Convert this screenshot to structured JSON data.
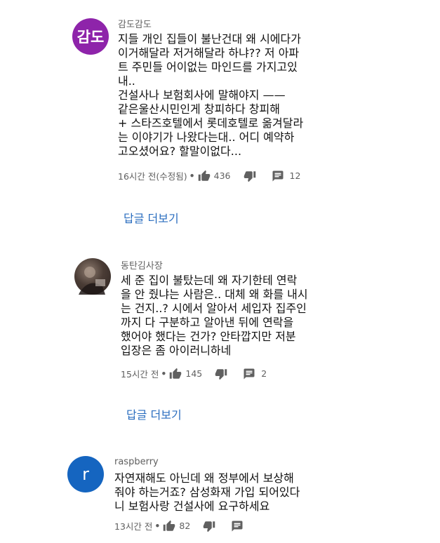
{
  "comments": [
    {
      "author": "감도감도",
      "avatar_text": "감도",
      "avatar_color": "#8e24aa",
      "lines": [
        "지들 개인 집들이 불난건대 왜 시에다가",
        "이거해달라 저거해달라 하냐?? 저 아파",
        "트 주민들 어이없는 마인드를 가지고있",
        "내..",
        "건설사나 보험회사에 말해야지 ——",
        "같은울산시민인게 창피하다 창피해",
        "+ 스타즈호텔에서 롯데호텔로 옮겨달라",
        "는 이야기가 나왔다는대.. 어디 예약하",
        "고오셨어요? 할말이없다..."
      ],
      "time": "16시간 전(수정됨)",
      "likes": "436",
      "replies_count": "12",
      "reply_more": "답글 더보기"
    },
    {
      "author": "동탄김사장",
      "avatar_text": "",
      "avatar_color": "#5a4a42",
      "lines": [
        "세 준 집이 불탔는데 왜 자기한테 연락",
        "을 안 줬냐는 사람은.. 대체 왜 화를 내시",
        "는 건지..? 시에서 알아서 세입자 집주인",
        "까지 다 구분하고 알아낸 뒤에 연락을",
        "했어야 했다는 건가? 안타깝지만 저분",
        "입장은 좀 아이러니하네"
      ],
      "time": "15시간 전",
      "likes": "145",
      "replies_count": "2",
      "reply_more": "답글 더보기"
    },
    {
      "author": "raspberry",
      "avatar_text": "r",
      "avatar_color": "#1565c0",
      "lines": [
        "자연재해도 아닌데 왜 정부에서 보상해",
        "줘야 하는거죠? 삼성화재 가입 되어있다",
        "니 보험사랑 건설사에 요구하세요"
      ],
      "time": "13시간 전",
      "likes": "82",
      "replies_count": ""
    }
  ]
}
